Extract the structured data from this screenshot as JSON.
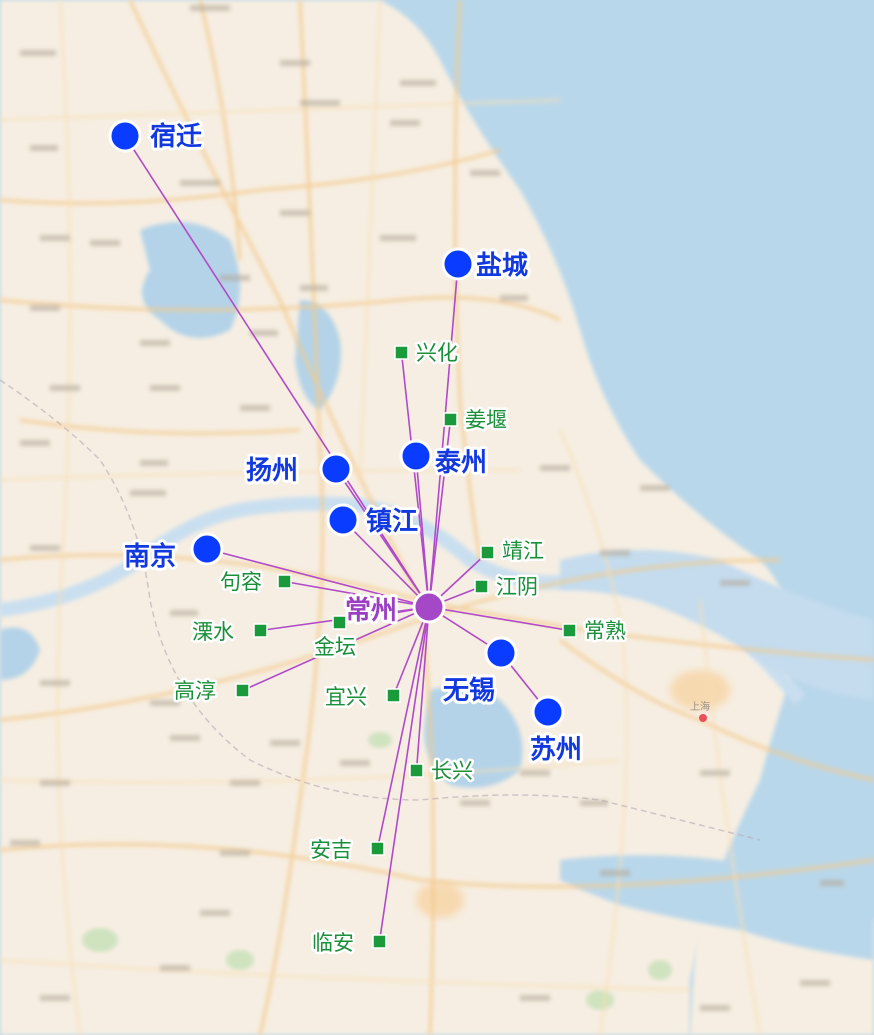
{
  "colors": {
    "sea": "#b9d7ea",
    "land": "#f6eee2",
    "lake": "#b4d3e8",
    "road_major": "#f3c98c",
    "road_minor": "#f8dfb6",
    "route_line": "#b04ac8",
    "hub_dot": "#a548c8",
    "hub_label": "#9b3fc2",
    "city_dot": "#0a3cff",
    "city_label": "#1238e0",
    "county_marker": "#1a9a3a",
    "county_label": "#1a8f3a"
  },
  "hub": {
    "name": "常州"
  },
  "cities": [
    {
      "id": "suqian",
      "name": "宿迁"
    },
    {
      "id": "yancheng",
      "name": "盐城"
    },
    {
      "id": "yangzhou",
      "name": "扬州"
    },
    {
      "id": "taizhou",
      "name": "泰州"
    },
    {
      "id": "zhenjiang",
      "name": "镇江"
    },
    {
      "id": "nanjing",
      "name": "南京"
    },
    {
      "id": "wuxi",
      "name": "无锡"
    },
    {
      "id": "suzhou",
      "name": "苏州"
    }
  ],
  "counties": [
    {
      "id": "xinghua",
      "name": "兴化"
    },
    {
      "id": "jiangyan",
      "name": "姜堰"
    },
    {
      "id": "jingjiang",
      "name": "靖江"
    },
    {
      "id": "jiangyin",
      "name": "江阴"
    },
    {
      "id": "changshu",
      "name": "常熟"
    },
    {
      "id": "jurong",
      "name": "句容"
    },
    {
      "id": "jintan",
      "name": "金坛"
    },
    {
      "id": "liyang",
      "name": "溧水"
    },
    {
      "id": "gaochun",
      "name": "高淳"
    },
    {
      "id": "yixing",
      "name": "宜兴"
    },
    {
      "id": "changxing",
      "name": "长兴"
    },
    {
      "id": "anji",
      "name": "安吉"
    },
    {
      "id": "linan",
      "name": "临安"
    }
  ],
  "basemap_labels": [
    "上海"
  ]
}
